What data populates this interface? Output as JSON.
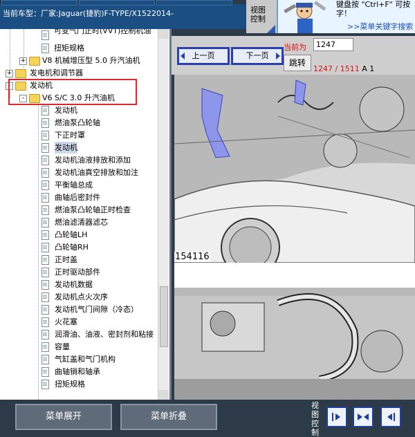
{
  "header": {
    "vehicle_label": "当前车型：厂家:Jaguar(捷豹)F-TYPE/X1522014-"
  },
  "view_control": {
    "label": "视图控制"
  },
  "help": {
    "text": "键盘按 \"Ctrl+F\" 可按字！",
    "link": ">>菜单关键字搜索"
  },
  "tree": {
    "items": [
      {
        "label": "可变气门正时(VVT)控制机油",
        "level": 2,
        "type": "doc"
      },
      {
        "label": "扭矩规格",
        "level": 2,
        "type": "doc"
      },
      {
        "label": "V8 机械增压型 5.0 升汽油机",
        "level": 1,
        "type": "folder",
        "expander": "+"
      },
      {
        "label": "发电机和调节器",
        "level": 0,
        "type": "folder",
        "expander": "+"
      },
      {
        "label": "发动机",
        "level": 0,
        "type": "folder",
        "expander": "-"
      },
      {
        "label": "V6 S/C 3.0 升汽油机",
        "level": 1,
        "type": "folder",
        "expander": "-"
      },
      {
        "label": "发动机",
        "level": 2,
        "type": "doc"
      },
      {
        "label": "燃油泵凸轮轴",
        "level": 2,
        "type": "doc"
      },
      {
        "label": "下正时罩",
        "level": 2,
        "type": "doc"
      },
      {
        "label": "发动机",
        "level": 2,
        "type": "doc",
        "selected": true
      },
      {
        "label": "发动机油液排放和添加",
        "level": 2,
        "type": "doc"
      },
      {
        "label": "发动机油真空排放和加注",
        "level": 2,
        "type": "doc"
      },
      {
        "label": "平衡轴总成",
        "level": 2,
        "type": "doc"
      },
      {
        "label": "曲轴后密封件",
        "level": 2,
        "type": "doc"
      },
      {
        "label": "燃油泵凸轮轴正时检查",
        "level": 2,
        "type": "doc"
      },
      {
        "label": "燃油滤清器滤芯",
        "level": 2,
        "type": "doc"
      },
      {
        "label": "凸轮轴LH",
        "level": 2,
        "type": "doc"
      },
      {
        "label": "凸轮轴RH",
        "level": 2,
        "type": "doc"
      },
      {
        "label": "正时盖",
        "level": 2,
        "type": "doc"
      },
      {
        "label": "正时驱动部件",
        "level": 2,
        "type": "doc"
      },
      {
        "label": "发动机数据",
        "level": 2,
        "type": "doc"
      },
      {
        "label": "发动机点火次序",
        "level": 2,
        "type": "doc"
      },
      {
        "label": "发动机气门间隙（冷态）",
        "level": 2,
        "type": "doc"
      },
      {
        "label": "火花塞",
        "level": 2,
        "type": "doc"
      },
      {
        "label": "润滑油、油液、密封剂和粘接",
        "level": 2,
        "type": "doc"
      },
      {
        "label": "容量",
        "level": 2,
        "type": "doc"
      },
      {
        "label": "气缸盖和气门机构",
        "level": 2,
        "type": "doc"
      },
      {
        "label": "曲轴销和轴承",
        "level": 2,
        "type": "doc"
      },
      {
        "label": "扭矩规格",
        "level": 2,
        "type": "doc"
      }
    ]
  },
  "nav": {
    "prev_label": "上一页",
    "next_label": "下一页",
    "current_label": "当前为",
    "page_value": "1247",
    "jump_label": "跳转",
    "page_status": "1247 / 1511",
    "page_suffix": "A 1"
  },
  "diagram": {
    "id": "154116"
  },
  "bottom": {
    "expand_label": "菜单展开",
    "collapse_label": "菜单折叠",
    "view_control_label": "视图控制"
  },
  "colors": {
    "header_bg": "#1b4f84",
    "highlight": "#e0262b",
    "nav_border": "#2b3fb0",
    "page_red": "#e01010"
  }
}
